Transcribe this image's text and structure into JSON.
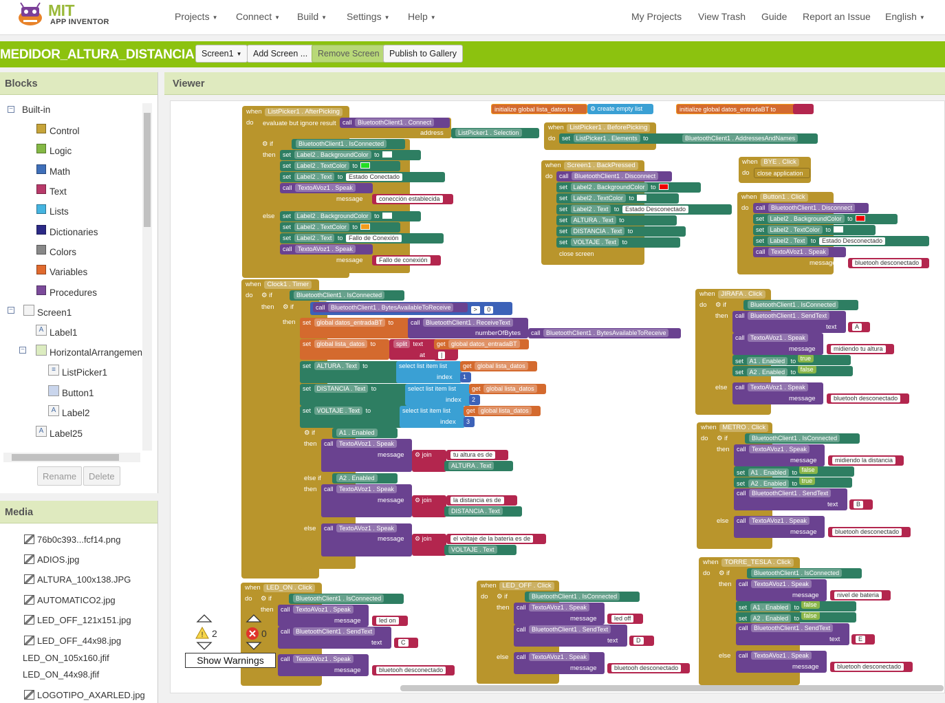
{
  "app": {
    "logo_mit": "MIT",
    "logo_sub": "APP INVENTOR"
  },
  "nav": {
    "projects": "Projects",
    "connect": "Connect",
    "build": "Build",
    "settings": "Settings",
    "help": "Help",
    "my_projects": "My Projects",
    "view_trash": "View Trash",
    "guide": "Guide",
    "report": "Report an Issue",
    "language": "English"
  },
  "project": {
    "name": "MEDIDOR_ALTURA_DISTANCIA",
    "screen": "Screen1",
    "add_screen": "Add Screen ...",
    "remove_screen": "Remove Screen",
    "publish": "Publish to Gallery"
  },
  "blocks_panel": {
    "title": "Blocks",
    "builtin": "Built-in",
    "categories": [
      {
        "label": "Control",
        "color": "#c6a43a"
      },
      {
        "label": "Logic",
        "color": "#84b845"
      },
      {
        "label": "Math",
        "color": "#3f6fb9"
      },
      {
        "label": "Text",
        "color": "#b83a6a"
      },
      {
        "label": "Lists",
        "color": "#45b4e0"
      },
      {
        "label": "Dictionaries",
        "color": "#2c2a86"
      },
      {
        "label": "Colors",
        "color": "#888888"
      },
      {
        "label": "Variables",
        "color": "#e06a2e"
      },
      {
        "label": "Procedures",
        "color": "#7b4a9a"
      }
    ],
    "screen1": "Screen1",
    "components": [
      "Label1",
      "HorizontalArrangemen",
      "ListPicker1",
      "Button1",
      "Label2",
      "Label25"
    ],
    "rename": "Rename",
    "delete": "Delete"
  },
  "media_panel": {
    "title": "Media",
    "files": [
      "76b0c393...fcf14.png",
      "ADIOS.jpg",
      "ALTURA_100x138.JPG",
      "AUTOMATICO2.jpg",
      "LED_OFF_121x151.jpg",
      "LED_OFF_44x98.jpg",
      "LED_ON_105x160.jfif",
      "LED_ON_44x98.jfif",
      "LOGOTIPO_AXARLED.jpg"
    ]
  },
  "viewer": {
    "title": "Viewer",
    "warnings_count": "2",
    "errors_count": "0",
    "show_warnings": "Show Warnings"
  },
  "blocks": {
    "when": "when",
    "do": "do",
    "then": "then",
    "else": "else",
    "else_if": "else if",
    "if": "if",
    "set": "set",
    "call": "call",
    "to": "to",
    "get": "get",
    "join": "join",
    "message": "message",
    "text": "text",
    "index": "index",
    "at": "at",
    "address": "address",
    "numberOfBytes": "numberOfBytes",
    "afterpicking": "ListPicker1 . AfterPicking",
    "evaluate": "evaluate but ignore result",
    "bt_connect": "BluetoothClient1 . Connect",
    "listpicker_selection": "ListPicker1 . Selection",
    "bt_isconnected": "BluetoothClient1 . IsConnected",
    "label2_bg": "Label2 . BackgroundColor",
    "label2_textcolor": "Label2 . TextColor",
    "label2_text": "Label2 . Text",
    "estado_conectado": "Estado Conectado",
    "speak": "TextoAVoz1 . Speak",
    "conexion_establecida": "conección establecida",
    "fallo_conexion_1": "Fallo de Conexión",
    "fallo_conexion_2": "Fallo de conexión",
    "init_lista": "initialize global lista_datos",
    "create_empty_list": "create empty list",
    "init_datos": "initialize global datos_entradaBT",
    "beforepicking": "ListPicker1 . BeforePicking",
    "listpicker_elements": "ListPicker1 . Elements",
    "addresses": "BluetoothClient1 . AddressesAndNames",
    "backpressed": "Screen1 . BackPressed",
    "bt_disconnect": "BluetoothClient1 . Disconnect",
    "estado_desconectado": "Estado Desconectado",
    "altura_text": "ALTURA . Text",
    "distancia_text": "DISTANCIA . Text",
    "voltaje_text": "VOLTAJE . Text",
    "close_screen": "close screen",
    "bye_click": "BYE . Click",
    "close_application": "close application",
    "button1_click": "Button1 . Click",
    "bluetooh_desconectado": "bluetooh desconectado",
    "clock_timer": "Clock1 . Timer",
    "bytes_available": "BluetoothClient1 . BytesAvailableToReceive",
    "zero": "0",
    "gt": ">",
    "set_datos": "global datos_entradaBT",
    "receive_text": "BluetoothClient1 . ReceiveText",
    "set_lista": "global lista_datos",
    "split": "split",
    "get_datos": "global datos_entradaBT",
    "split_at": "|",
    "select_list_item": "select list item  list",
    "get_lista": "global lista_datos",
    "idx1": "1",
    "idx2": "2",
    "idx3": "3",
    "a1_enabled": "A1 . Enabled",
    "a2_enabled": "A2 . Enabled",
    "tu_altura": "tu altura es de",
    "la_distancia": "la distancia es de",
    "el_voltaje": "el voltaje de la bateria es de",
    "jirafa_click": "JIRAFA . Click",
    "send_text": "BluetoothClient1 . SendText",
    "char_a": "A",
    "char_b": "B",
    "char_c": "C",
    "char_d": "D",
    "char_e": "E",
    "midiendo_altura": "midiendo tu altura",
    "midiendo_distancia": "midiendo la distancia",
    "nivel_bateria": "nivel de bateria",
    "true": "true",
    "false": "false",
    "metro_click": "METRO . Click",
    "torre_click": "TORRE_TESLA . Click",
    "led_on_click": "LED_ON . Click",
    "led_off_click": "LED_OFF . Click",
    "led_on": "led on",
    "led_off": "led off"
  }
}
